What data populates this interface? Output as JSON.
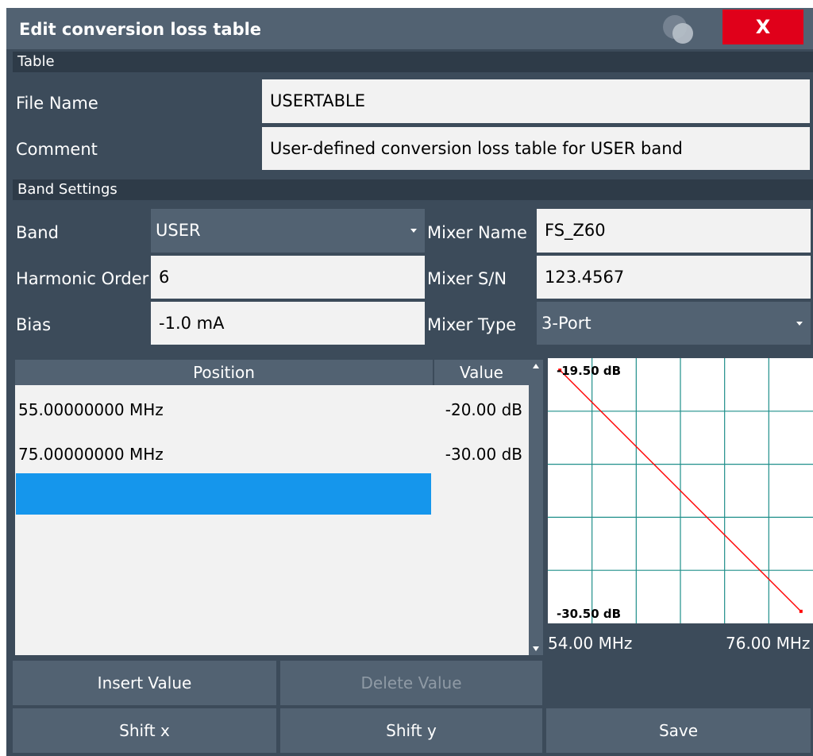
{
  "dialog": {
    "title": "Edit conversion loss table",
    "close_label": "X"
  },
  "table_section": {
    "header": "Table",
    "file_name_label": "File Name",
    "file_name_value": "USERTABLE",
    "comment_label": "Comment",
    "comment_value": "User-defined conversion loss table for USER band"
  },
  "band_section": {
    "header": "Band Settings",
    "band_label": "Band",
    "band_value": "USER",
    "mixer_name_label": "Mixer Name",
    "mixer_name_value": "FS_Z60",
    "harmonic_order_label": "Harmonic Order",
    "harmonic_order_value": "6",
    "mixer_sn_label": "Mixer S/N",
    "mixer_sn_value": "123.4567",
    "bias_label": "Bias",
    "bias_value": "-1.0 mA",
    "mixer_type_label": "Mixer Type",
    "mixer_type_value": "3-Port"
  },
  "loss_table": {
    "columns": [
      "Position",
      "Value"
    ],
    "rows": [
      {
        "position": "55.00000000 MHz",
        "value": "-20.00 dB"
      },
      {
        "position": "75.00000000 MHz",
        "value": "-30.00 dB"
      }
    ]
  },
  "chart": {
    "y_top_label": "-19.50 dB",
    "y_bottom_label": "-30.50 dB",
    "x_left_label": "54.00 MHz",
    "x_right_label": "76.00 MHz"
  },
  "chart_data": {
    "type": "line",
    "title": "",
    "xlabel": "",
    "ylabel": "",
    "xlim": [
      54,
      76
    ],
    "ylim": [
      -30.5,
      -19.5
    ],
    "grid": true,
    "series": [
      {
        "x": [
          55,
          75
        ],
        "y": [
          -20,
          -30
        ]
      }
    ]
  },
  "buttons": {
    "insert_value": "Insert Value",
    "delete_value": "Delete Value",
    "shift_x": "Shift x",
    "shift_y": "Shift y",
    "save": "Save"
  },
  "colors": {
    "dialog_bg": "#3c4b5a",
    "accent_red": "#e0001a",
    "selection_blue": "#1596ec",
    "grid_teal": "#1f8f8a",
    "trace_red": "#ff0000"
  }
}
